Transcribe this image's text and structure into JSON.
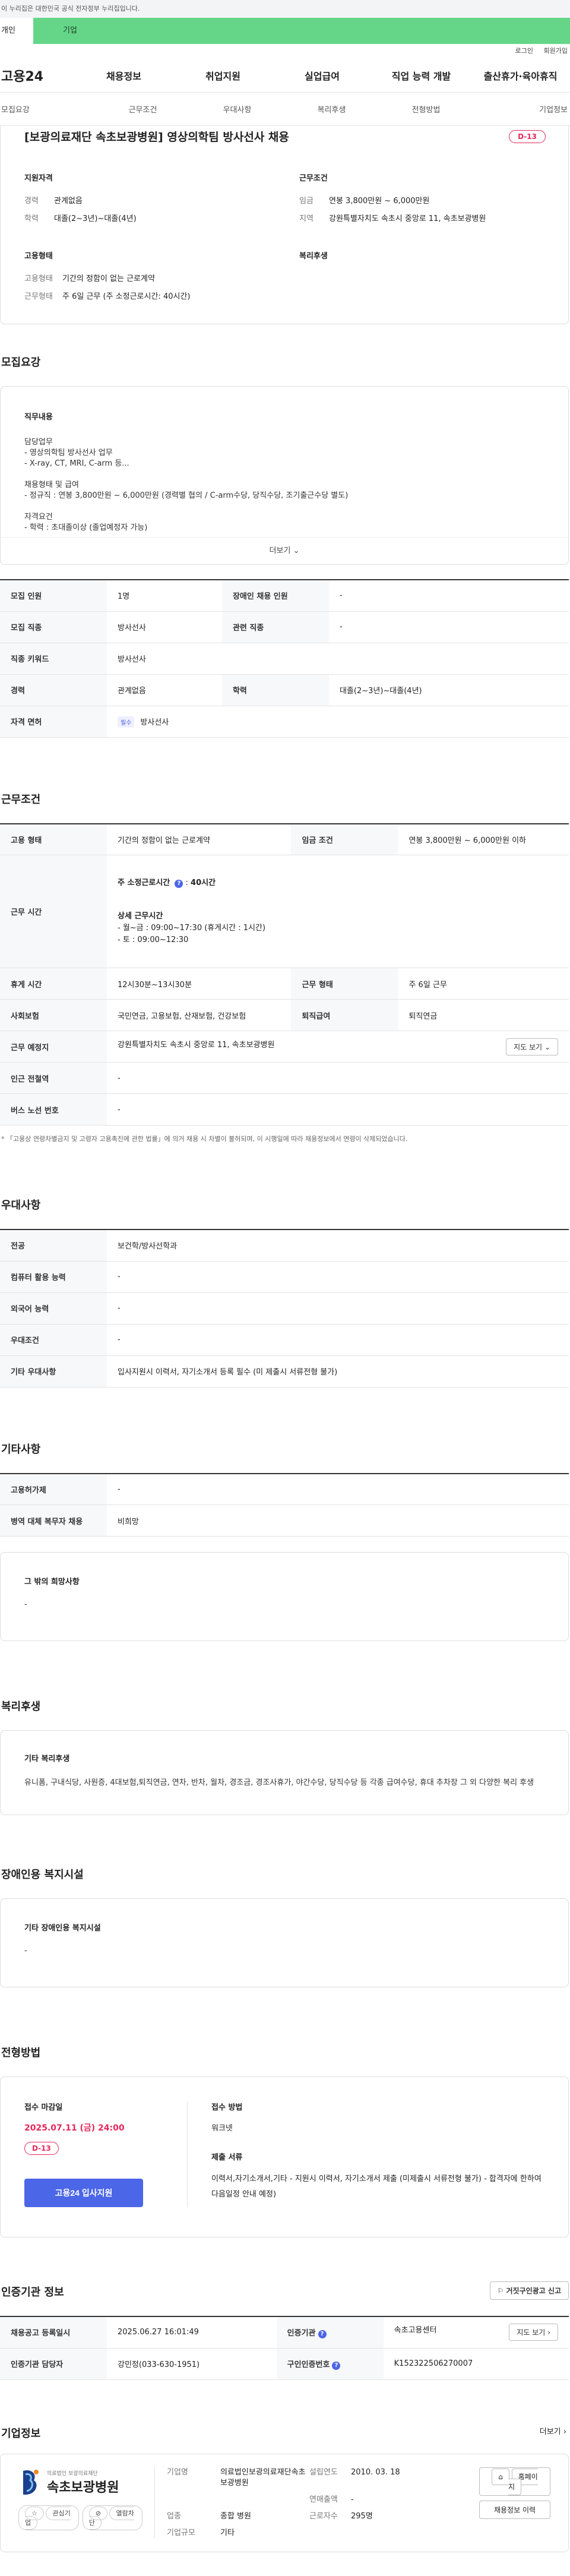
{
  "topbar": {
    "notice": "이 누리집은 대한민국 공식 전자정부 누리집입니다."
  },
  "userbar": {
    "tab_personal": "개인",
    "tab_company": "기업"
  },
  "util": {
    "login": "로그인",
    "join": "회원가입"
  },
  "gnb": {
    "logo": "고용24",
    "menu": [
      "채용정보",
      "취업지원",
      "실업급여",
      "직업 능력 개발",
      "출산휴가·육아휴직"
    ]
  },
  "tabs": [
    "모집요강",
    "근무조건",
    "우대사항",
    "복리후생",
    "전형방법",
    "기업정보"
  ],
  "summary": {
    "title": "[보광의료재단 속초보광병원] 영상의학팀 방사선사 채용",
    "dday": "D-13",
    "qual_title": "지원자격",
    "qual": [
      {
        "k": "경력",
        "v": "관계없음"
      },
      {
        "k": "학력",
        "v": "대졸(2~3년)~대졸(4년)"
      }
    ],
    "work_title": "근무조건",
    "work": [
      {
        "k": "임금",
        "v": "연봉 3,800만원 ~ 6,000만원"
      },
      {
        "k": "지역",
        "v": "강원특별자치도 속초시 중앙로 11, 속초보광병원"
      }
    ],
    "emp_title": "고용형태",
    "emp": [
      {
        "k": "고용형태",
        "v": "기간의 정함이 없는 근로계약"
      },
      {
        "k": "근무형태",
        "v": "주 6일 근무 (주 소정근로시간: 40시간)"
      }
    ],
    "welfare_title": "복리후생"
  },
  "recruit": {
    "title": "모집요강",
    "desc_title": "직무내용",
    "desc_lines": [
      "담당업무",
      "- 영상의학팀 방사선사 업무",
      "- X-ray, CT, MRI, C-arm 등...",
      "",
      "채용형태 및 급여",
      "- 정규직 : 연봉 3,800만원 ~ 6,000만원 (경력별 협의 / C-arm수당, 당직수당, 조기출근수당 별도)",
      "",
      "자격요건",
      "- 학력 : 초대졸이상 (졸업예정자 가능)"
    ],
    "more": "더보기",
    "rows": [
      {
        "k1": "모집 인원",
        "v1": "1명",
        "k2": "장애인 채용 인원",
        "v2": "-"
      },
      {
        "k1": "모집 직종",
        "v1": "방사선사",
        "k2": "관련 직종",
        "v2": "-"
      },
      {
        "k1": "직종 키워드",
        "v1": "방사선사"
      },
      {
        "k1": "경력",
        "v1": "관계없음",
        "k2": "학력",
        "v2": "대졸(2~3년)~대졸(4년)"
      },
      {
        "k1": "자격 면허",
        "tag": "필수",
        "v1": "방사선사"
      }
    ]
  },
  "workcond": {
    "title": "근무조건",
    "emp_k": "고용 형태",
    "emp_v": "기간의 정함이 없는 근로계약",
    "wage_k": "임금 조건",
    "wage_v": "연봉 3,800만원 ~ 6,000만원 이하",
    "time_k": "근무 시간",
    "time_week": "주 소정근로시간",
    "time_week_v": "40시간",
    "time_detail": "상세 근무시간",
    "time_lines": [
      "- 월~금 : 09:00~17:30 (휴게시간 : 1시간)",
      "- 토 : 09:00~12:30"
    ],
    "rest_k": "휴게 시간",
    "rest_v": "12시30분~13시30분",
    "shift_k": "근무 형태",
    "shift_v": "주 6일 근무",
    "ins_k": "사회보험",
    "ins_v": "국민연금, 고용보험, 산재보험, 건강보험",
    "ret_k": "퇴직급여",
    "ret_v": "퇴직연금",
    "place_k": "근무 예정지",
    "place_v": "강원특별자치도 속초시 중앙로 11, 속초보광병원",
    "map_btn": "지도 보기",
    "subway_k": "인근 전철역",
    "subway_v": "-",
    "bus_k": "버스 노선 번호",
    "bus_v": "-",
    "note": "* 「고용상 연령차별금지 및 고령자 고용촉진에 관한 법률」에 의거 채용 시 차별이 불허되며, 이 시행일에 따라 채용정보에서 연령이 삭제되었습니다."
  },
  "pref": {
    "title": "우대사항",
    "rows": [
      {
        "k": "전공",
        "v": "보건학/방사선학과"
      },
      {
        "k": "컴퓨터 활용 능력",
        "v": "-"
      },
      {
        "k": "외국어 능력",
        "v": "-"
      },
      {
        "k": "우대조건",
        "v": "-"
      },
      {
        "k": "기타 우대사항",
        "v": "입사지원시 이력서, 자기소개서 등록 필수 (미 제출시 서류전형 불가)"
      }
    ]
  },
  "etc": {
    "title": "기타사항",
    "rows": [
      {
        "k": "고용허가제",
        "v": "-"
      },
      {
        "k": "병역 대체 복무자 채용",
        "v": "비희망"
      }
    ],
    "other_title": "그 밖의 희망사항",
    "other_v": "-"
  },
  "welfare": {
    "title": "복리후생",
    "box_title": "기타 복리후생",
    "box_text": "유니폼, 구내식당, 사원증, 4대보험,퇴직연금, 연차, 반차, 월차, 경조금, 경조사휴가, 야간수당, 당직수당 등 각종 급여수당, 휴대 추차장 그 외 다양한 복리 후생"
  },
  "disability": {
    "title": "장애인용 복지시설",
    "box_title": "기타 장애인용 복지시설",
    "box_v": "-"
  },
  "process": {
    "title": "전형방법",
    "deadline_title": "접수 마감일",
    "deadline": "2025.07.11 (금) 24:00",
    "dday": "D-13",
    "apply_btn": "고용24 입사지원",
    "method_title": "접수 방법",
    "method_v": "워크넷",
    "docs_title": "제출 서류",
    "docs_v": "이력서,자기소개서,기타 - 지원시 이력서, 자기소개서 제출 (미제출시 서류전형 불가) - 합격자에 한하여 다음일정 안내 예정)"
  },
  "cert": {
    "title": "인증기관 정보",
    "report_btn": "거짓구인광고 신고",
    "reg_k": "채용공고 등록일시",
    "reg_v": "2025.06.27 16:01:49",
    "org_k": "인증기관",
    "org_v": "속초고용센터",
    "map_btn": "지도 보기",
    "mgr_k": "인증기관 담당자",
    "mgr_v": "강민정(033-630-1951)",
    "num_k": "구인인증번호",
    "num_v": "K152322506270007"
  },
  "company": {
    "title": "기업정보",
    "more": "더보기",
    "logo_small": "의료법인 보광의료재단",
    "logo_name": "속초보광병원",
    "btn_interest": "관심기업",
    "btn_hide": "열람차단",
    "name_k": "기업명",
    "name_v": "의료법인보광의료재단속초보광병원",
    "est_k": "설립연도",
    "est_v": "2010. 03. 18",
    "sales_k": "연매출액",
    "sales_v": "-",
    "ind_k": "업종",
    "ind_v": "종합 병원",
    "emp_k": "근로자수",
    "emp_v": "295명",
    "size_k": "기업규모",
    "size_v": "기타",
    "homepage": "홈페이지",
    "moreinfo": "채용정보 이력"
  }
}
